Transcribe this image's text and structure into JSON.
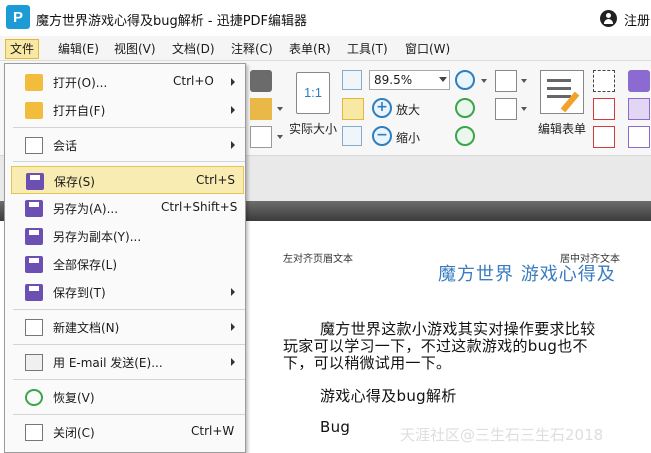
{
  "window": {
    "logo_letter": "P",
    "title": "魔方世界游戏心得及bug解析 - 迅捷PDF编辑器",
    "register": "注册"
  },
  "menubar": {
    "items": [
      "文件",
      "编辑(E)",
      "视图(V)",
      "文档(D)",
      "注释(C)",
      "表单(R)",
      "工具(T)",
      "窗口(W)"
    ]
  },
  "toolbar": {
    "zoom_value": "89.5%",
    "actual_size": "实际大小",
    "actual_size_icon_text": "1:1",
    "zoom_in": "放大",
    "zoom_out": "缩小",
    "edit_form": "编辑表单"
  },
  "file_menu": {
    "items": [
      {
        "label": "打开(O)...",
        "shortcut": "Ctrl+O",
        "icon": "folder-open-icon",
        "submenu": true
      },
      {
        "label": "打开自(F)",
        "shortcut": "",
        "icon": "folder-globe-icon",
        "submenu": true
      },
      {
        "label": "会话",
        "shortcut": "",
        "icon": "session-icon",
        "submenu": true
      },
      {
        "label": "保存(S)",
        "shortcut": "Ctrl+S",
        "icon": "save-icon",
        "submenu": false,
        "highlighted": true
      },
      {
        "label": "另存为(A)...",
        "shortcut": "Ctrl+Shift+S",
        "icon": "save-as-icon",
        "submenu": false
      },
      {
        "label": "另存为副本(Y)...",
        "shortcut": "",
        "icon": "save-copy-icon",
        "submenu": false
      },
      {
        "label": "全部保存(L)",
        "shortcut": "",
        "icon": "save-all-icon",
        "submenu": false
      },
      {
        "label": "保存到(T)",
        "shortcut": "",
        "icon": "save-to-icon",
        "submenu": true
      },
      {
        "label": "新建文档(N)",
        "shortcut": "",
        "icon": "new-document-icon",
        "submenu": true
      },
      {
        "label": "用 E-mail 发送(E)...",
        "shortcut": "",
        "icon": "email-icon",
        "submenu": true
      },
      {
        "label": "恢复(V)",
        "shortcut": "",
        "icon": "revert-icon",
        "submenu": false
      },
      {
        "label": "关闭(C)",
        "shortcut": "Ctrl+W",
        "icon": "close-document-icon",
        "submenu": false
      }
    ]
  },
  "document": {
    "header_left": "左对齐页眉文本",
    "header_center": "居中对齐文本",
    "title": "魔方世界 游戏心得及",
    "para1_line1": "魔方世界这款小游戏其实对操作要求比较",
    "para1_line2": "玩家可以学习一下，不过这款游戏的bug也不",
    "para1_line3": "下，可以稍微试用一下。",
    "heading2": "游戏心得及bug解析",
    "heading3": "Bug"
  },
  "watermark": "天涯社区@三生石三生石2018"
}
